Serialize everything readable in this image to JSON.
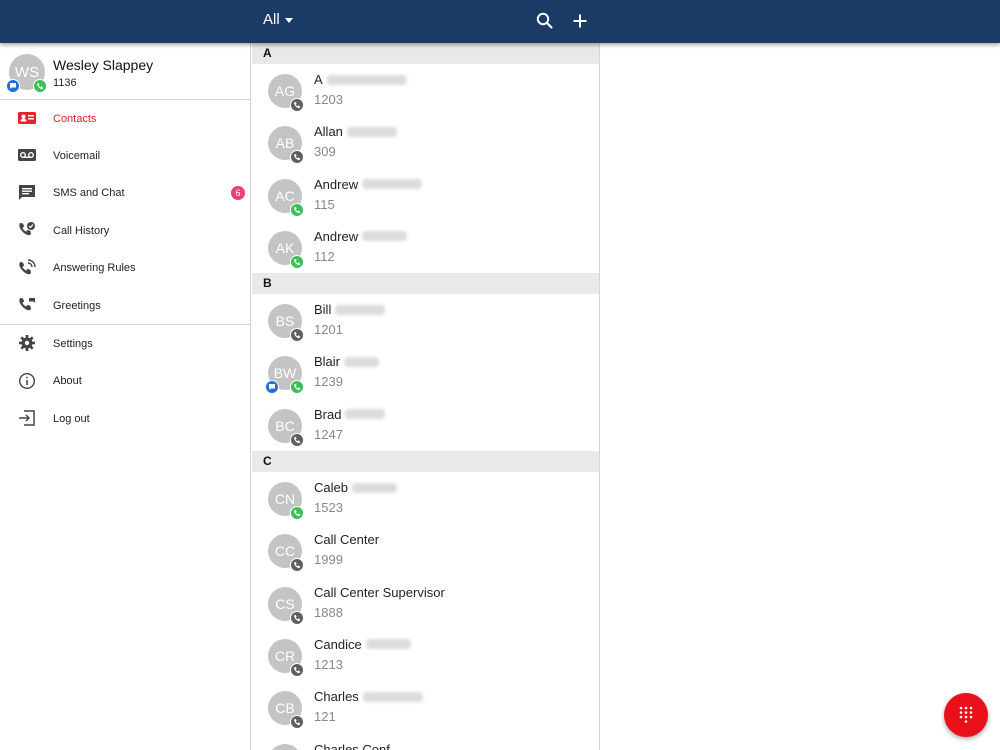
{
  "topbar": {
    "filter_label": "All",
    "icons": [
      "search-icon",
      "plus-icon"
    ]
  },
  "profile": {
    "initials": "WS",
    "name": "Wesley Slappey",
    "extension": "1136",
    "status_icons": [
      "chat-icon",
      "phone-icon"
    ]
  },
  "nav": {
    "items": [
      {
        "label": "Contacts",
        "icon": "contacts-icon",
        "active": true
      },
      {
        "label": "Voicemail",
        "icon": "voicemail-icon"
      },
      {
        "label": "SMS and Chat",
        "icon": "message-icon",
        "count": "6"
      },
      {
        "label": "Call History",
        "icon": "call-history-icon"
      },
      {
        "label": "Answering Rules",
        "icon": "answering-rules-icon"
      },
      {
        "label": "Greetings",
        "icon": "greetings-icon"
      }
    ],
    "secondary": [
      {
        "label": "Settings",
        "icon": "gear-icon"
      },
      {
        "label": "About",
        "icon": "info-icon"
      },
      {
        "label": "Log out",
        "icon": "logout-icon"
      }
    ]
  },
  "sections": [
    {
      "letter": "A",
      "contacts": [
        {
          "initials": "AG",
          "first": "A",
          "ext": "1203",
          "status": "gray"
        },
        {
          "initials": "AB",
          "first": "Allan",
          "ext": "309",
          "status": "gray"
        },
        {
          "initials": "AC",
          "first": "Andrew",
          "ext": "115",
          "status": "green"
        },
        {
          "initials": "AK",
          "first": "Andrew",
          "ext": "112",
          "status": "green"
        }
      ]
    },
    {
      "letter": "B",
      "contacts": [
        {
          "initials": "BS",
          "first": "Bill",
          "ext": "1201",
          "status": "gray"
        },
        {
          "initials": "BW",
          "first": "Blair",
          "ext": "1239",
          "status": "green",
          "chat": true
        },
        {
          "initials": "BC",
          "first": "Brad",
          "ext": "1247",
          "status": "gray"
        }
      ]
    },
    {
      "letter": "C",
      "contacts": [
        {
          "initials": "CN",
          "first": "Caleb",
          "ext": "1523",
          "status": "green"
        },
        {
          "initials": "CC",
          "first": "Call Center",
          "ext": "1999",
          "status": "gray"
        },
        {
          "initials": "CS",
          "first": "Call Center Supervisor",
          "ext": "1888",
          "status": "gray"
        },
        {
          "initials": "CR",
          "first": "Candice",
          "ext": "1213",
          "status": "gray"
        },
        {
          "initials": "CB",
          "first": "Charles",
          "ext": "121",
          "status": "gray"
        },
        {
          "initials": "",
          "first": "Charles Conf",
          "ext": "",
          "status": "gray"
        }
      ]
    }
  ],
  "colors": {
    "topbar": "#1c3a66",
    "accent": "#e8222a",
    "fab": "#e8101b",
    "online": "#3cbf58",
    "chat": "#1f6fd6"
  },
  "fab": {
    "icon": "dialpad-icon"
  }
}
